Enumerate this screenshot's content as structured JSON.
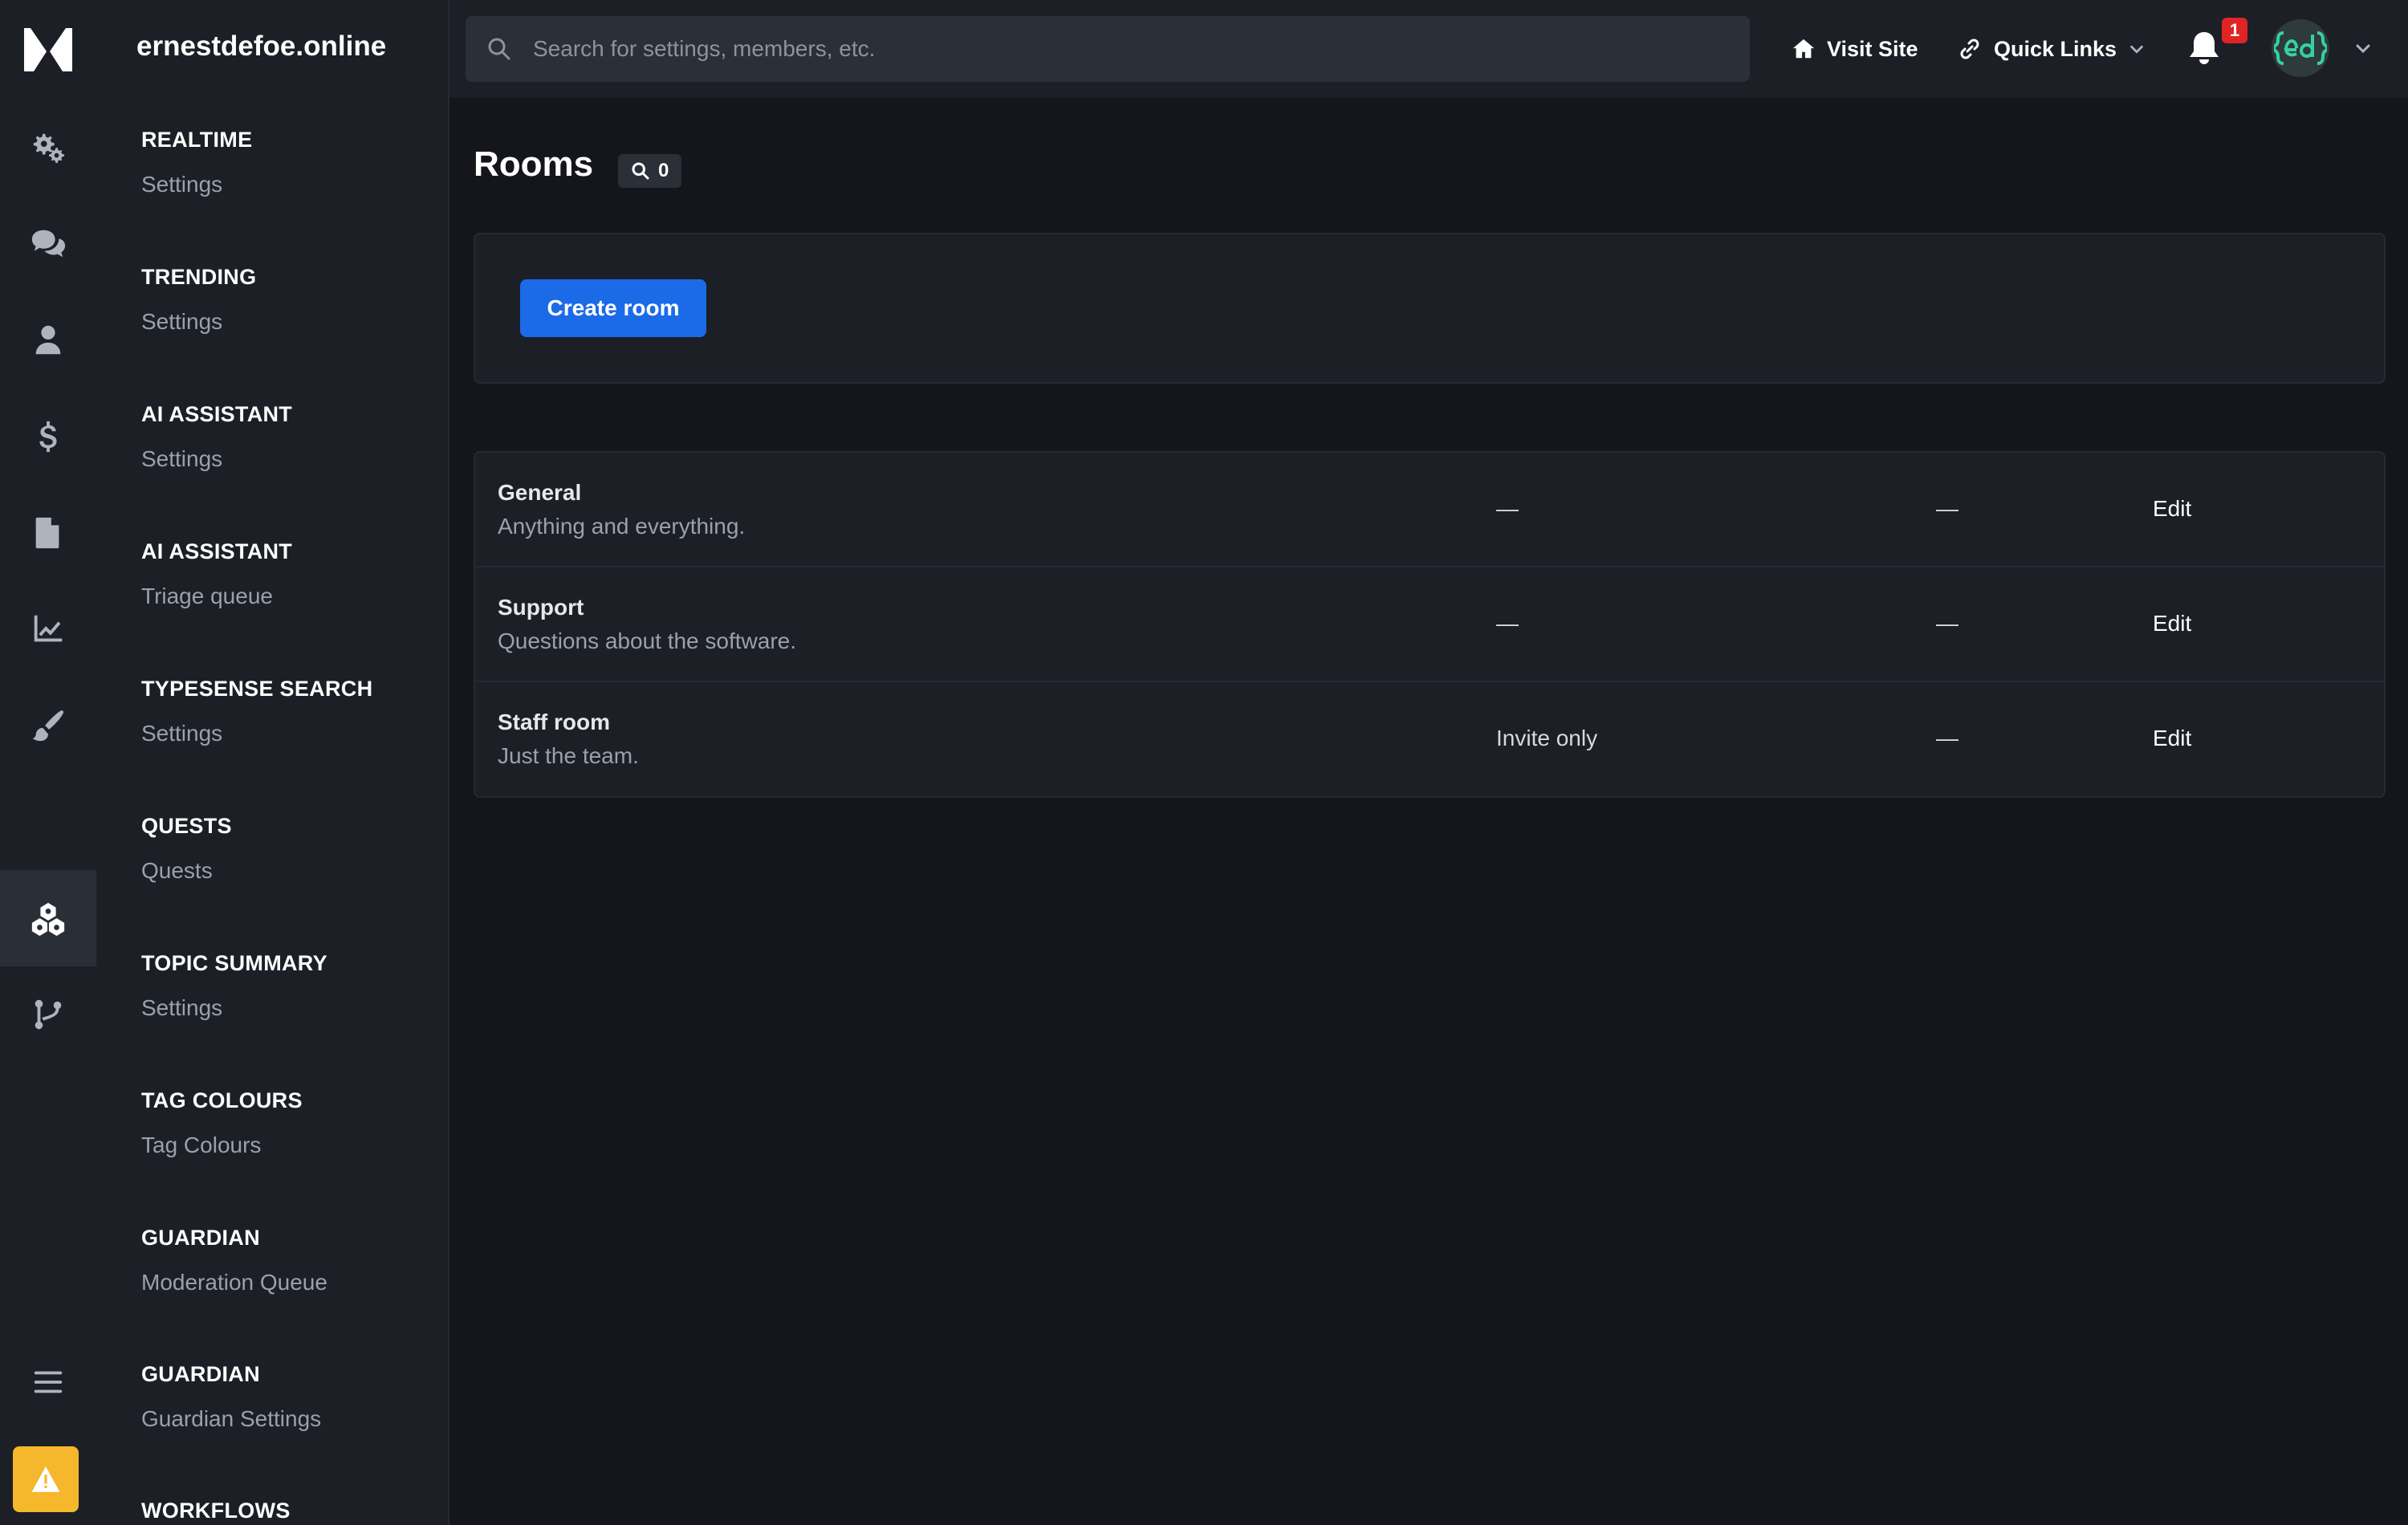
{
  "site": {
    "name": "ernestdefoe.online"
  },
  "search": {
    "placeholder": "Search for settings, members, etc."
  },
  "topbar": {
    "visit_site": "Visit Site",
    "quick_links": "Quick Links",
    "notification_count": "1"
  },
  "rail": {
    "icons": [
      "settings-gears-icon",
      "chat-icon",
      "user-icon",
      "dollar-icon",
      "file-icon",
      "chart-line-icon",
      "paintbrush-icon",
      "plugins-icon",
      "branch-icon",
      "menu-icon",
      "warning-icon"
    ],
    "active": "plugins-icon"
  },
  "sidebar": {
    "groups": [
      {
        "title": "REALTIME",
        "link": "Settings"
      },
      {
        "title": "TRENDING",
        "link": "Settings"
      },
      {
        "title": "AI ASSISTANT",
        "link": "Settings"
      },
      {
        "title": "AI ASSISTANT",
        "link": "Triage queue"
      },
      {
        "title": "TYPESENSE SEARCH",
        "link": "Settings"
      },
      {
        "title": "QUESTS",
        "link": "Quests"
      },
      {
        "title": "TOPIC SUMMARY",
        "link": "Settings"
      },
      {
        "title": "TAG COLOURS",
        "link": "Tag Colours"
      },
      {
        "title": "GUARDIAN",
        "link": "Moderation Queue"
      },
      {
        "title": "GUARDIAN",
        "link": "Guardian Settings"
      },
      {
        "title": "WORKFLOWS",
        "link": ""
      }
    ]
  },
  "main": {
    "title": "Rooms",
    "count": "0",
    "create_button": "Create room",
    "rooms": [
      {
        "name": "General",
        "description": "Anything and everything.",
        "access": "—",
        "extra": "—",
        "action": "Edit"
      },
      {
        "name": "Support",
        "description": "Questions about the software.",
        "access": "—",
        "extra": "—",
        "action": "Edit"
      },
      {
        "name": "Staff room",
        "description": "Just the team.",
        "access": "Invite only",
        "extra": "—",
        "action": "Edit"
      }
    ]
  },
  "colors": {
    "background": "#14161b",
    "panel": "#1c1f26",
    "accent": "#1b6be8",
    "warning": "#f5b72b",
    "badge": "#e02424"
  }
}
